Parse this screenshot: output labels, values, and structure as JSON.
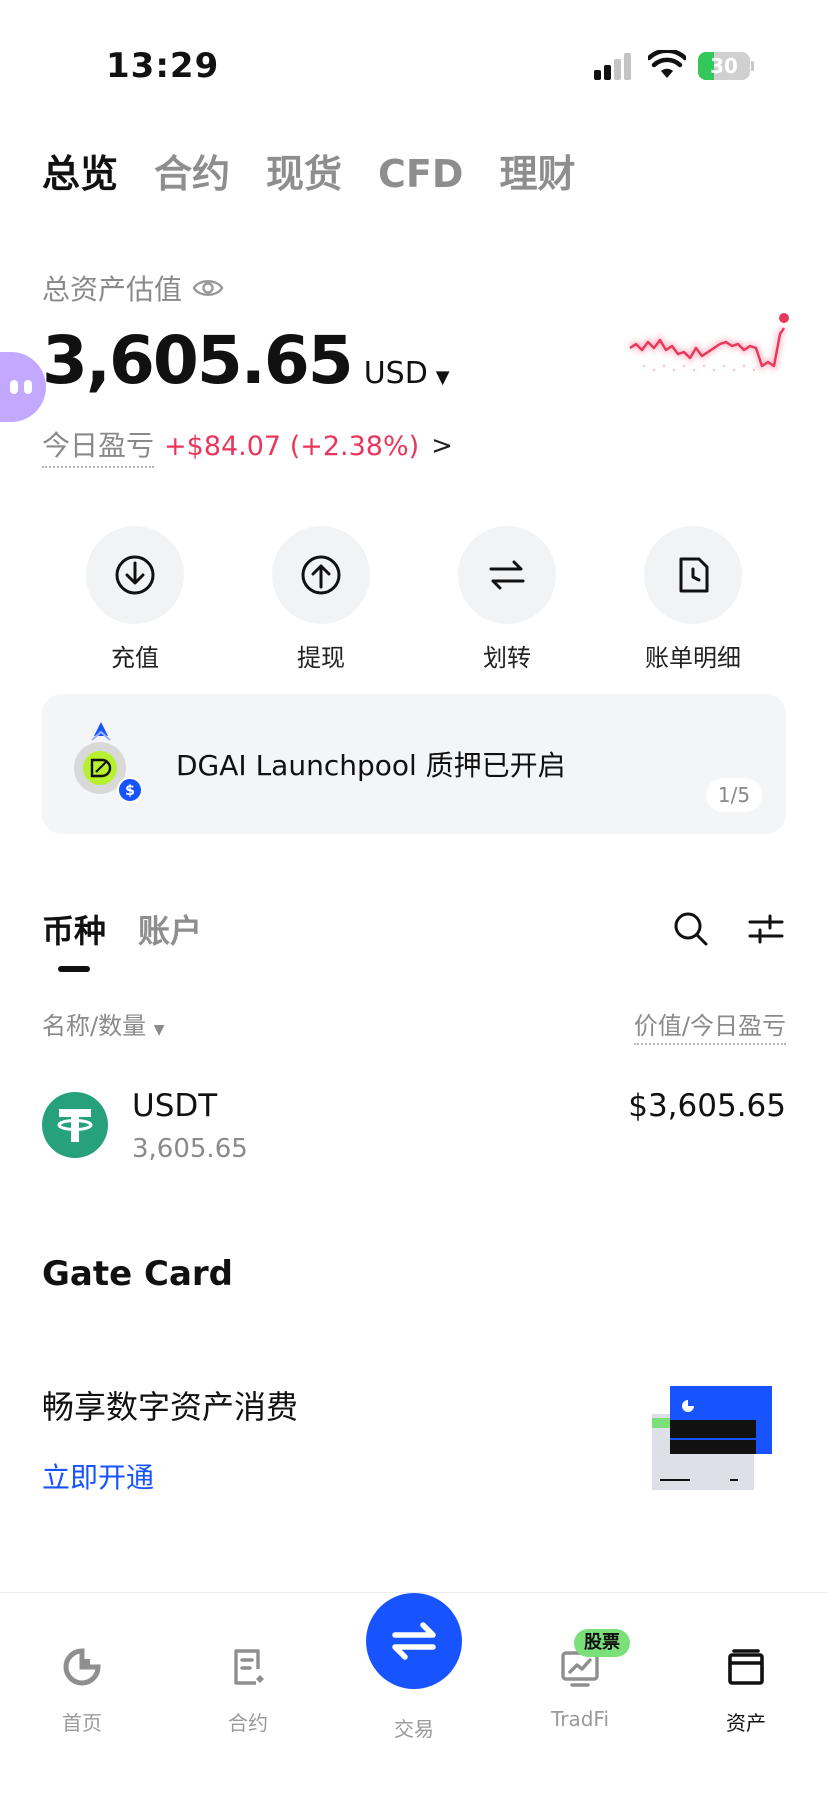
{
  "status_bar": {
    "time": "13:29",
    "battery": "30",
    "battery_level": 0.3
  },
  "top_tabs": [
    {
      "label": "总览",
      "active": true
    },
    {
      "label": "合约",
      "active": false
    },
    {
      "label": "现货",
      "active": false
    },
    {
      "label": "CFD",
      "active": false
    },
    {
      "label": "理财",
      "active": false
    }
  ],
  "summary": {
    "label": "总资产估值",
    "balance": "3,605.65",
    "currency": "USD",
    "pnl_label": "今日盈亏",
    "pnl_value": "+$84.07 (+2.38%)",
    "pnl_color": "#e8365c"
  },
  "actions": [
    {
      "label": "充值",
      "icon": "deposit-icon"
    },
    {
      "label": "提现",
      "icon": "withdraw-icon"
    },
    {
      "label": "划转",
      "icon": "transfer-icon"
    },
    {
      "label": "账单明细",
      "icon": "bill-icon"
    }
  ],
  "banner": {
    "text": "DGAI Launchpool 质押已开启",
    "pager": "1/5"
  },
  "asset_tabs": [
    {
      "label": "币种",
      "active": true
    },
    {
      "label": "账户",
      "active": false
    }
  ],
  "list_header": {
    "left": "名称/数量",
    "right": "价值/今日盈亏"
  },
  "coins": [
    {
      "name": "USDT",
      "quantity": "3,605.65",
      "value": "$3,605.65"
    }
  ],
  "gate_card": {
    "title": "Gate Card",
    "description": "畅享数字资产消费",
    "cta": "立即开通"
  },
  "bottom_nav": {
    "home": "首页",
    "futures": "合约",
    "trade": "交易",
    "tradfi": "TradFi",
    "tradfi_badge": "股票",
    "assets": "资产"
  },
  "colors": {
    "accent": "#1754ff",
    "negative_pnl_text": "#e8365c",
    "usdt": "#26a17b",
    "badge": "#7be07a"
  }
}
